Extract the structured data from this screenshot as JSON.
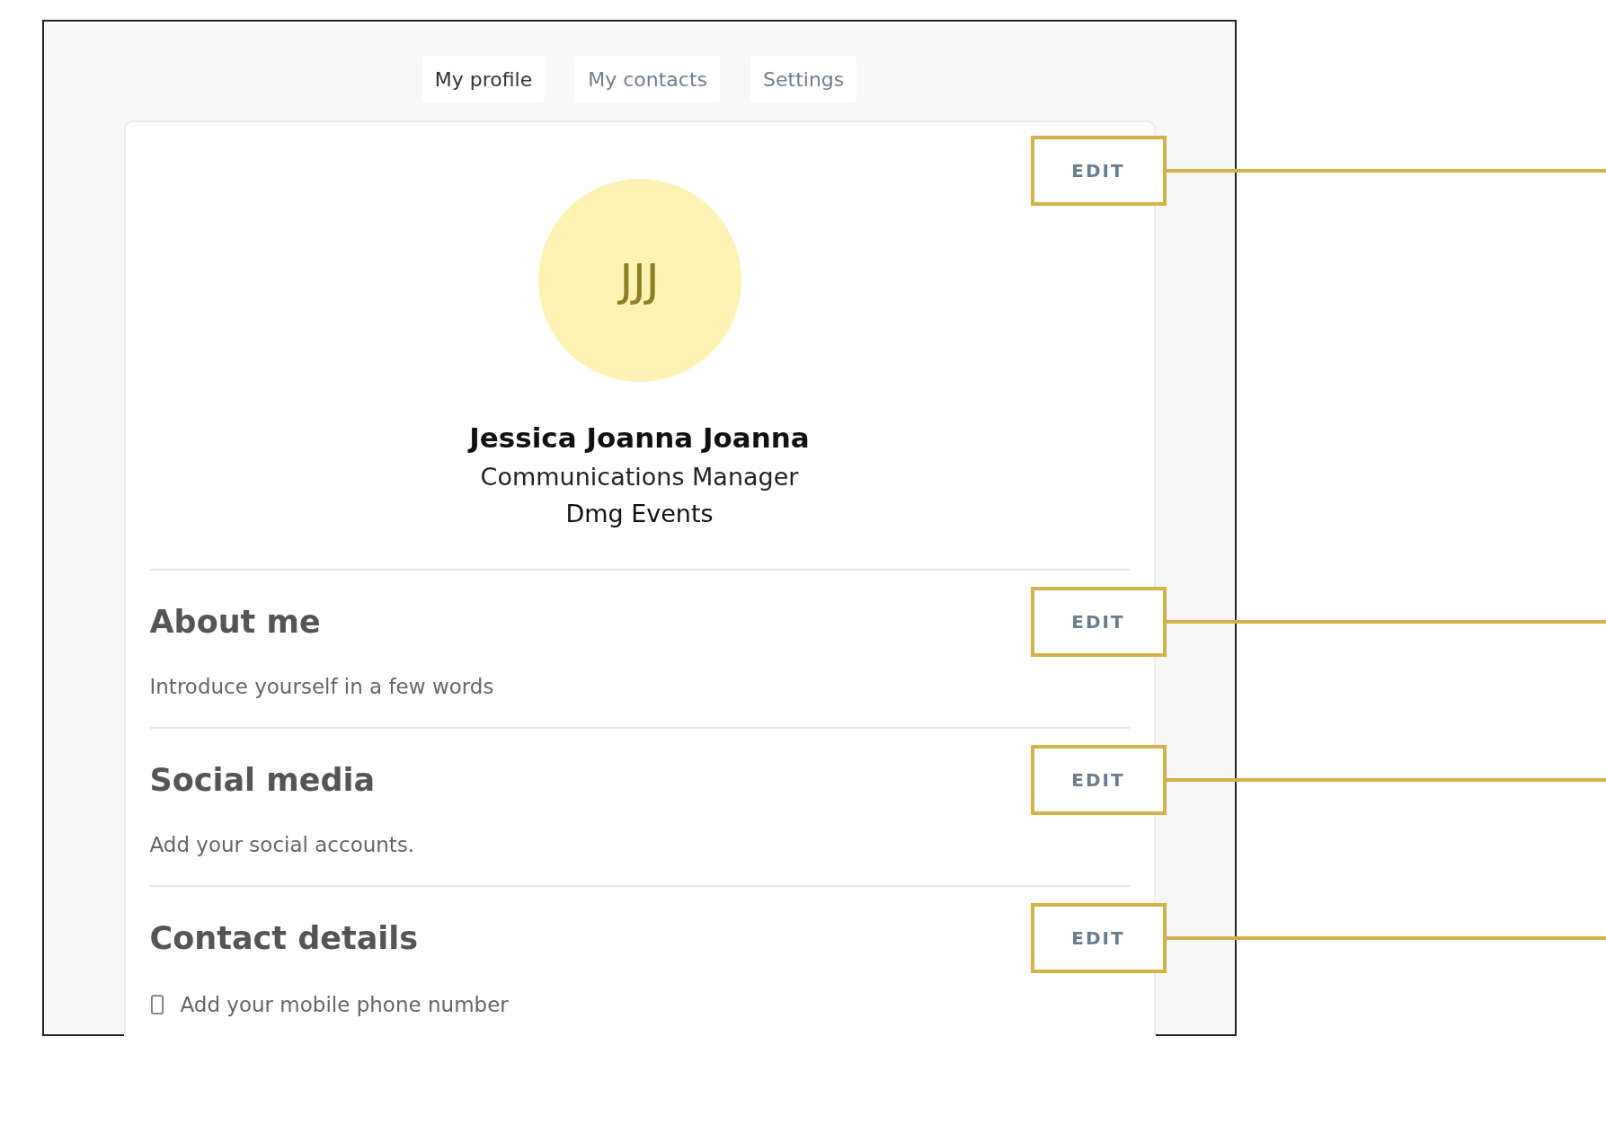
{
  "tabs": [
    {
      "label": "My profile",
      "selected": true
    },
    {
      "label": "My contacts",
      "selected": false
    },
    {
      "label": "Settings",
      "selected": false
    }
  ],
  "profile": {
    "initials": "JJJ",
    "name": "Jessica Joanna Joanna",
    "job_title": "Communications Manager",
    "company": "Dmg Events",
    "edit": {
      "label": "EDIT",
      "highlighted": true
    }
  },
  "sections": [
    {
      "kind": "text",
      "title": "About me",
      "text": "Introduce yourself in a few words",
      "edit": {
        "label": "EDIT",
        "highlighted": true
      }
    },
    {
      "kind": "text",
      "title": "Social media",
      "text": "Add your social accounts.",
      "edit": {
        "label": "EDIT",
        "highlighted": true
      }
    },
    {
      "kind": "contact",
      "title": "Contact details",
      "text": "Add your mobile phone number",
      "edit": {
        "label": "EDIT",
        "highlighted": true
      }
    }
  ]
}
